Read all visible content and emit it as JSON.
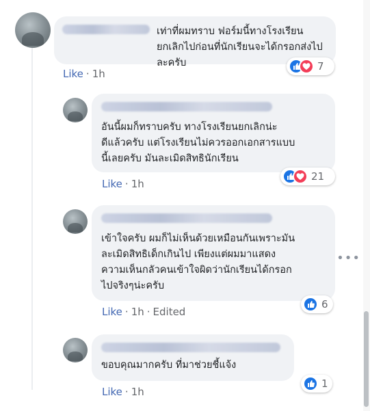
{
  "comments": [
    {
      "text": "เท่าที่ผมทราบ ฟอร์มนี้ทางโรงเรียน\nยกเลิกไปก่อนที่นักเรียนจะได้กรอกส่งไปละครับ",
      "like_label": "Like",
      "time": "1h",
      "reactions": [
        "like",
        "love"
      ],
      "reaction_count": "7"
    },
    {
      "text": "อันนี้ผมก็ทราบครับ ทางโรงเรียนยกเลิกน่ะ\nดีแล้วครับ แต่โรงเรียนไม่ควรออกเอกสารแบบ\nนี้เลยครับ มันละเมิดสิทธินักเรียน",
      "like_label": "Like",
      "time": "1h",
      "reactions": [
        "like",
        "love"
      ],
      "reaction_count": "21"
    },
    {
      "text": "เข้าใจครับ ผมก็ไม่เห็นด้วยเหมือนกันเพราะมัน\nละเมิดสิทธิเด็กเกินไป เพียงแต่ผมมาแสดง\nความเห็นกลัวคนเข้าใจผิดว่านักเรียนได้กรอก\nไปจริงๆน่ะครับ",
      "like_label": "Like",
      "time": "1h",
      "edited": "Edited",
      "reactions": [
        "like"
      ],
      "reaction_count": "6"
    },
    {
      "text": "ขอบคุณมากครับ ที่มาช่วยชี้แจ้ง",
      "like_label": "Like",
      "time": "1h",
      "reactions": [
        "like"
      ],
      "reaction_count": "1"
    }
  ],
  "more_options": "•••",
  "colors": {
    "bubble": "#f0f2f5",
    "like_link": "#4267b2",
    "like_reaction": "#1b74e4",
    "love_reaction": "#f33e58"
  }
}
